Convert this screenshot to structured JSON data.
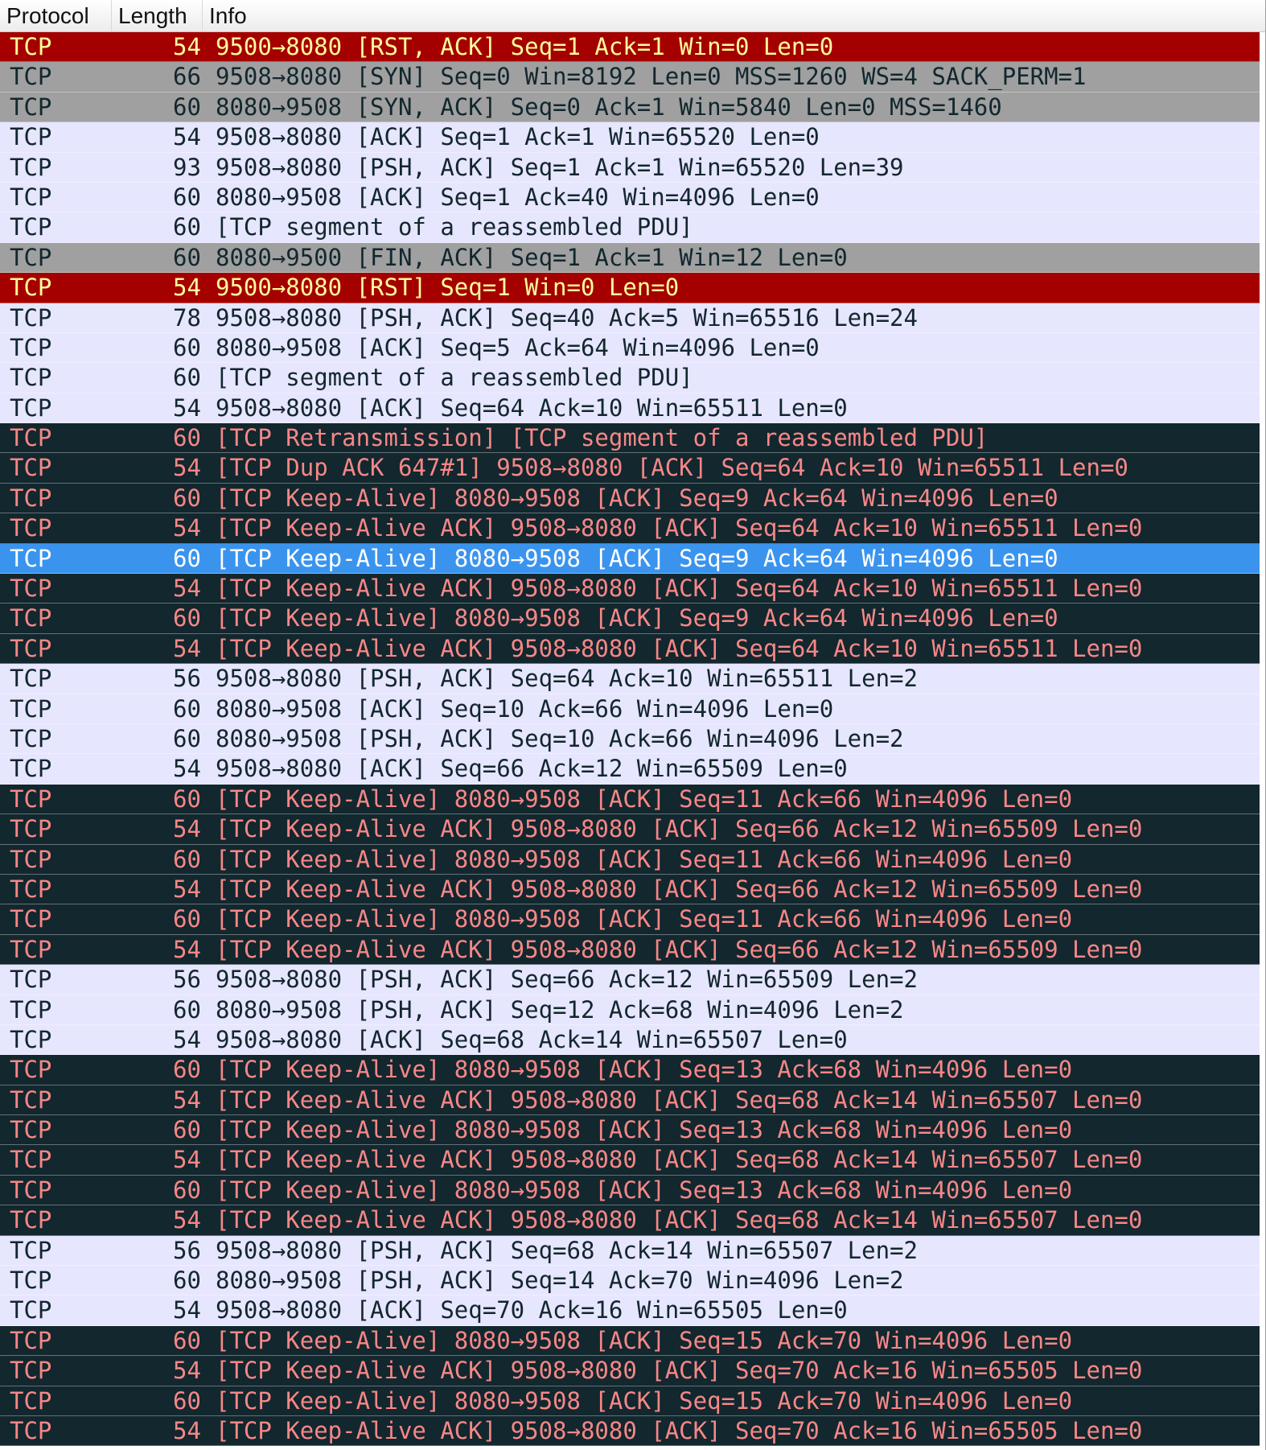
{
  "columns": {
    "protocol": "Protocol",
    "length": "Length",
    "info": "Info"
  },
  "colors": {
    "normal_bg": "#e7e6ff",
    "normal_fg": "#12272e",
    "syn_fin_bg": "#a0a0a0",
    "rst_bg": "#a40000",
    "rst_fg": "#fffc9c",
    "bad_tcp_bg": "#12272e",
    "bad_tcp_fg": "#f78787",
    "selected_bg": "#3a94ee",
    "selected_fg": "#ffffff"
  },
  "rows": [
    {
      "protocol": "TCP",
      "length": "54",
      "info": "9500→8080 [RST, ACK] Seq=1 Ack=1 Win=0 Len=0",
      "style": "rst"
    },
    {
      "protocol": "TCP",
      "length": "66",
      "info": "9508→8080 [SYN] Seq=0 Win=8192 Len=0 MSS=1260 WS=4 SACK_PERM=1",
      "style": "gray"
    },
    {
      "protocol": "TCP",
      "length": "60",
      "info": "8080→9508 [SYN, ACK] Seq=0 Ack=1 Win=5840 Len=0 MSS=1460",
      "style": "gray"
    },
    {
      "protocol": "TCP",
      "length": "54",
      "info": "9508→8080 [ACK] Seq=1 Ack=1 Win=65520 Len=0",
      "style": "normal"
    },
    {
      "protocol": "TCP",
      "length": "93",
      "info": "9508→8080 [PSH, ACK] Seq=1 Ack=1 Win=65520 Len=39",
      "style": "normal"
    },
    {
      "protocol": "TCP",
      "length": "60",
      "info": "8080→9508 [ACK] Seq=1 Ack=40 Win=4096 Len=0",
      "style": "normal"
    },
    {
      "protocol": "TCP",
      "length": "60",
      "info": "[TCP segment of a reassembled PDU]",
      "style": "normal"
    },
    {
      "protocol": "TCP",
      "length": "60",
      "info": "8080→9500 [FIN, ACK] Seq=1 Ack=1 Win=12 Len=0",
      "style": "gray"
    },
    {
      "protocol": "TCP",
      "length": "54",
      "info": "9500→8080 [RST] Seq=1 Win=0 Len=0",
      "style": "rst"
    },
    {
      "protocol": "TCP",
      "length": "78",
      "info": "9508→8080 [PSH, ACK] Seq=40 Ack=5 Win=65516 Len=24",
      "style": "normal"
    },
    {
      "protocol": "TCP",
      "length": "60",
      "info": "8080→9508 [ACK] Seq=5 Ack=64 Win=4096 Len=0",
      "style": "normal"
    },
    {
      "protocol": "TCP",
      "length": "60",
      "info": "[TCP segment of a reassembled PDU]",
      "style": "normal"
    },
    {
      "protocol": "TCP",
      "length": "54",
      "info": "9508→8080 [ACK] Seq=64 Ack=10 Win=65511 Len=0",
      "style": "normal"
    },
    {
      "protocol": "TCP",
      "length": "60",
      "info": "[TCP Retransmission] [TCP segment of a reassembled PDU]",
      "style": "bad"
    },
    {
      "protocol": "TCP",
      "length": "54",
      "info": "[TCP Dup ACK 647#1] 9508→8080 [ACK] Seq=64 Ack=10 Win=65511 Len=0",
      "style": "bad"
    },
    {
      "protocol": "TCP",
      "length": "60",
      "info": "[TCP Keep-Alive] 8080→9508 [ACK] Seq=9 Ack=64 Win=4096 Len=0",
      "style": "bad"
    },
    {
      "protocol": "TCP",
      "length": "54",
      "info": "[TCP Keep-Alive ACK] 9508→8080 [ACK] Seq=64 Ack=10 Win=65511 Len=0",
      "style": "bad"
    },
    {
      "protocol": "TCP",
      "length": "60",
      "info": "[TCP Keep-Alive] 8080→9508 [ACK] Seq=9 Ack=64 Win=4096 Len=0",
      "style": "selected"
    },
    {
      "protocol": "TCP",
      "length": "54",
      "info": "[TCP Keep-Alive ACK] 9508→8080 [ACK] Seq=64 Ack=10 Win=65511 Len=0",
      "style": "bad"
    },
    {
      "protocol": "TCP",
      "length": "60",
      "info": "[TCP Keep-Alive] 8080→9508 [ACK] Seq=9 Ack=64 Win=4096 Len=0",
      "style": "bad"
    },
    {
      "protocol": "TCP",
      "length": "54",
      "info": "[TCP Keep-Alive ACK] 9508→8080 [ACK] Seq=64 Ack=10 Win=65511 Len=0",
      "style": "bad"
    },
    {
      "protocol": "TCP",
      "length": "56",
      "info": "9508→8080 [PSH, ACK] Seq=64 Ack=10 Win=65511 Len=2",
      "style": "normal"
    },
    {
      "protocol": "TCP",
      "length": "60",
      "info": "8080→9508 [ACK] Seq=10 Ack=66 Win=4096 Len=0",
      "style": "normal"
    },
    {
      "protocol": "TCP",
      "length": "60",
      "info": "8080→9508 [PSH, ACK] Seq=10 Ack=66 Win=4096 Len=2",
      "style": "normal"
    },
    {
      "protocol": "TCP",
      "length": "54",
      "info": "9508→8080 [ACK] Seq=66 Ack=12 Win=65509 Len=0",
      "style": "normal"
    },
    {
      "protocol": "TCP",
      "length": "60",
      "info": "[TCP Keep-Alive] 8080→9508 [ACK] Seq=11 Ack=66 Win=4096 Len=0",
      "style": "bad"
    },
    {
      "protocol": "TCP",
      "length": "54",
      "info": "[TCP Keep-Alive ACK] 9508→8080 [ACK] Seq=66 Ack=12 Win=65509 Len=0",
      "style": "bad"
    },
    {
      "protocol": "TCP",
      "length": "60",
      "info": "[TCP Keep-Alive] 8080→9508 [ACK] Seq=11 Ack=66 Win=4096 Len=0",
      "style": "bad"
    },
    {
      "protocol": "TCP",
      "length": "54",
      "info": "[TCP Keep-Alive ACK] 9508→8080 [ACK] Seq=66 Ack=12 Win=65509 Len=0",
      "style": "bad"
    },
    {
      "protocol": "TCP",
      "length": "60",
      "info": "[TCP Keep-Alive] 8080→9508 [ACK] Seq=11 Ack=66 Win=4096 Len=0",
      "style": "bad"
    },
    {
      "protocol": "TCP",
      "length": "54",
      "info": "[TCP Keep-Alive ACK] 9508→8080 [ACK] Seq=66 Ack=12 Win=65509 Len=0",
      "style": "bad"
    },
    {
      "protocol": "TCP",
      "length": "56",
      "info": "9508→8080 [PSH, ACK] Seq=66 Ack=12 Win=65509 Len=2",
      "style": "normal"
    },
    {
      "protocol": "TCP",
      "length": "60",
      "info": "8080→9508 [PSH, ACK] Seq=12 Ack=68 Win=4096 Len=2",
      "style": "normal"
    },
    {
      "protocol": "TCP",
      "length": "54",
      "info": "9508→8080 [ACK] Seq=68 Ack=14 Win=65507 Len=0",
      "style": "normal"
    },
    {
      "protocol": "TCP",
      "length": "60",
      "info": "[TCP Keep-Alive] 8080→9508 [ACK] Seq=13 Ack=68 Win=4096 Len=0",
      "style": "bad"
    },
    {
      "protocol": "TCP",
      "length": "54",
      "info": "[TCP Keep-Alive ACK] 9508→8080 [ACK] Seq=68 Ack=14 Win=65507 Len=0",
      "style": "bad"
    },
    {
      "protocol": "TCP",
      "length": "60",
      "info": "[TCP Keep-Alive] 8080→9508 [ACK] Seq=13 Ack=68 Win=4096 Len=0",
      "style": "bad"
    },
    {
      "protocol": "TCP",
      "length": "54",
      "info": "[TCP Keep-Alive ACK] 9508→8080 [ACK] Seq=68 Ack=14 Win=65507 Len=0",
      "style": "bad"
    },
    {
      "protocol": "TCP",
      "length": "60",
      "info": "[TCP Keep-Alive] 8080→9508 [ACK] Seq=13 Ack=68 Win=4096 Len=0",
      "style": "bad"
    },
    {
      "protocol": "TCP",
      "length": "54",
      "info": "[TCP Keep-Alive ACK] 9508→8080 [ACK] Seq=68 Ack=14 Win=65507 Len=0",
      "style": "bad"
    },
    {
      "protocol": "TCP",
      "length": "56",
      "info": "9508→8080 [PSH, ACK] Seq=68 Ack=14 Win=65507 Len=2",
      "style": "normal"
    },
    {
      "protocol": "TCP",
      "length": "60",
      "info": "8080→9508 [PSH, ACK] Seq=14 Ack=70 Win=4096 Len=2",
      "style": "normal"
    },
    {
      "protocol": "TCP",
      "length": "54",
      "info": "9508→8080 [ACK] Seq=70 Ack=16 Win=65505 Len=0",
      "style": "normal"
    },
    {
      "protocol": "TCP",
      "length": "60",
      "info": "[TCP Keep-Alive] 8080→9508 [ACK] Seq=15 Ack=70 Win=4096 Len=0",
      "style": "bad"
    },
    {
      "protocol": "TCP",
      "length": "54",
      "info": "[TCP Keep-Alive ACK] 9508→8080 [ACK] Seq=70 Ack=16 Win=65505 Len=0",
      "style": "bad"
    },
    {
      "protocol": "TCP",
      "length": "60",
      "info": "[TCP Keep-Alive] 8080→9508 [ACK] Seq=15 Ack=70 Win=4096 Len=0",
      "style": "bad"
    },
    {
      "protocol": "TCP",
      "length": "54",
      "info": "[TCP Keep-Alive ACK] 9508→8080 [ACK] Seq=70 Ack=16 Win=65505 Len=0",
      "style": "bad"
    }
  ]
}
